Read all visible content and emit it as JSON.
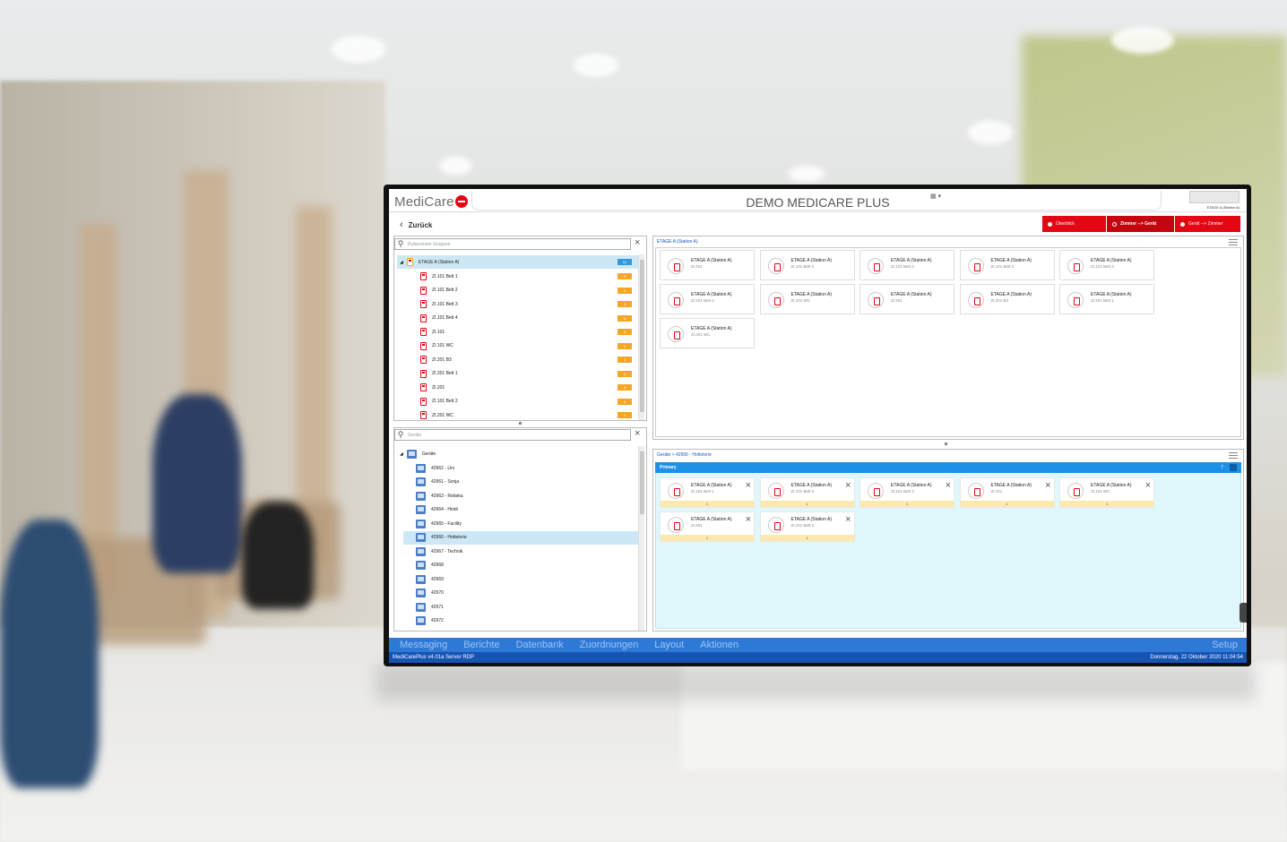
{
  "app": {
    "logo": "MediCare",
    "title": "DEMO MEDICARE PLUS",
    "context_label": "ETAGE A (Station A)",
    "back_label": "Zurück"
  },
  "modes": [
    {
      "label": "Überblick"
    },
    {
      "label": "Zimmer --> Gerät"
    },
    {
      "label": "Gerät --> Zimmer"
    }
  ],
  "groups": {
    "search_placeholder": "Rufausloser Gruppen",
    "root": {
      "label": "ETAGE A (Station A)",
      "count": "12"
    },
    "items": [
      {
        "label": "ZI.101 Bett 1",
        "count": "4"
      },
      {
        "label": "ZI.101 Bett 2",
        "count": "4"
      },
      {
        "label": "ZI.101 Bett 3",
        "count": "4"
      },
      {
        "label": "ZI.101 Bett 4",
        "count": "4"
      },
      {
        "label": "ZI.101",
        "count": "4"
      },
      {
        "label": "ZI.101 WC",
        "count": "4"
      },
      {
        "label": "ZI.201 B3",
        "count": "4"
      },
      {
        "label": "ZI.201 Bett 1",
        "count": "4"
      },
      {
        "label": "ZI.201",
        "count": "4"
      },
      {
        "label": "ZI.101 Bett 2",
        "count": "4"
      },
      {
        "label": "ZI.201 WC",
        "count": "4"
      }
    ]
  },
  "devices": {
    "search_placeholder": "Geräte",
    "root": "Geräte",
    "items": [
      {
        "label": "42962 - Urs"
      },
      {
        "label": "42961 - Sonja"
      },
      {
        "label": "42963 - Rebeka"
      },
      {
        "label": "42964 - Heidi"
      },
      {
        "label": "42965 - Facility"
      },
      {
        "label": "42966 - Hottelerie"
      },
      {
        "label": "42967 - Technik"
      },
      {
        "label": "42968"
      },
      {
        "label": "42969"
      },
      {
        "label": "42970"
      },
      {
        "label": "42971"
      },
      {
        "label": "42972"
      }
    ]
  },
  "rooms_pane": {
    "header": "ETAGE A (Station A)",
    "cards": [
      {
        "title": "ETAGE A (Station A)",
        "sub": "ZI.101"
      },
      {
        "title": "ETAGE A (Station A)",
        "sub": "ZI.101 Bett 1"
      },
      {
        "title": "ETAGE A (Station A)",
        "sub": "ZI.101 Bett 2"
      },
      {
        "title": "ETAGE A (Station A)",
        "sub": "ZI.101 Bett 2"
      },
      {
        "title": "ETAGE A (Station A)",
        "sub": "ZI.101 Bett 3"
      },
      {
        "title": "ETAGE A (Station A)",
        "sub": "ZI.101 Bett 4"
      },
      {
        "title": "ETAGE A (Station A)",
        "sub": "ZI.101 WC"
      },
      {
        "title": "ETAGE A (Station A)",
        "sub": "ZI.201"
      },
      {
        "title": "ETAGE A (Station A)",
        "sub": "ZI.201 B3"
      },
      {
        "title": "ETAGE A (Station A)",
        "sub": "ZI.201 Bett 1"
      },
      {
        "title": "ETAGE A (Station A)",
        "sub": "ZI.201 WC"
      }
    ]
  },
  "assign_pane": {
    "header": "Geräte > 42966 - Hottelerie",
    "group": "Primary",
    "group_count": "7",
    "cards": [
      {
        "title": "ETAGE A (Station A)",
        "sub": "ZI.101 Bett 1",
        "bar": "1"
      },
      {
        "title": "ETAGE A (Station A)",
        "sub": "ZI.101 Bett 2",
        "bar": "1"
      },
      {
        "title": "ETAGE A (Station A)",
        "sub": "ZI.101 Bett 3",
        "bar": "1"
      },
      {
        "title": "ETAGE A (Station A)",
        "sub": "ZI.101",
        "bar": "1"
      },
      {
        "title": "ETAGE A (Station A)",
        "sub": "ZI.101 WC",
        "bar": "1"
      },
      {
        "title": "ETAGE A (Station A)",
        "sub": "ZI.201",
        "bar": "1"
      },
      {
        "title": "ETAGE A (Station A)",
        "sub": "ZI.101 Bett 2",
        "bar": "1"
      }
    ]
  },
  "nav": [
    "Messaging",
    "Berichte",
    "Datenbank",
    "Zuordnungen",
    "Layout",
    "Aktionen"
  ],
  "nav_setup": "Setup",
  "status": {
    "left": "MediCarePlus v4.01a Server RDP",
    "right": "Donnerstag, 22 Oktober 2020  11:04:54"
  },
  "colors": {
    "accent": "#e30613",
    "nav": "#2f79d6",
    "status": "#1554b3",
    "primary": "#1e90e6"
  }
}
